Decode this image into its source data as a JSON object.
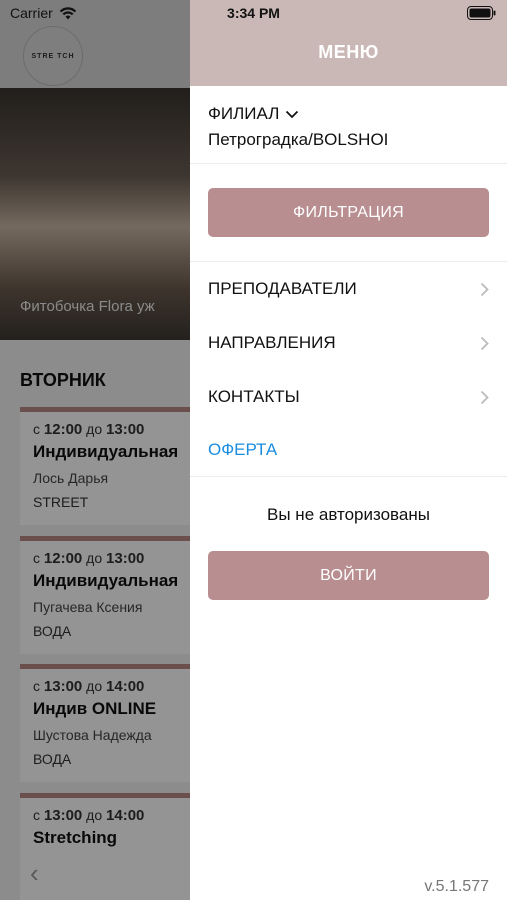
{
  "status_bar": {
    "carrier": "Carrier",
    "time": "3:34 PM"
  },
  "background": {
    "logo_text": "STRE TCH",
    "caption": "Фитобочка Flora уж",
    "day_title": "ВТОРНИК",
    "lessons": [
      {
        "from": "с",
        "start": "12:00",
        "to": "до",
        "end": "13:00",
        "name": "Индивидуальная",
        "teacher": "Лось Дарья",
        "type": "STREET"
      },
      {
        "from": "с",
        "start": "12:00",
        "to": "до",
        "end": "13:00",
        "name": "Индивидуальная",
        "teacher": "Пугачева Ксения",
        "type": "ВОДА"
      },
      {
        "from": "с",
        "start": "13:00",
        "to": "до",
        "end": "14:00",
        "name": "Индив ONLINE",
        "teacher": "Шустова Надежда",
        "type": "ВОДА"
      },
      {
        "from": "с",
        "start": "13:00",
        "to": "до",
        "end": "14:00",
        "name": "Stretching",
        "teacher": "",
        "type": ""
      }
    ]
  },
  "menu": {
    "title": "МЕНЮ",
    "branch_label": "ФИЛИАЛ",
    "branch_value": "Петроградка/BOLSHOI",
    "filter_button": "ФИЛЬТРАЦИЯ",
    "items": [
      {
        "label": "ПРЕПОДАВАТЕЛИ"
      },
      {
        "label": "НАПРАВЛЕНИЯ"
      },
      {
        "label": "КОНТАКТЫ"
      }
    ],
    "offer": "ОФЕРТА",
    "auth_status": "Вы не авторизованы",
    "login_button": "ВОЙТИ",
    "version": "v.5.1.577"
  },
  "colors": {
    "accent": "#b88e91",
    "header": "#c9b8b6",
    "link": "#1a8de0"
  }
}
